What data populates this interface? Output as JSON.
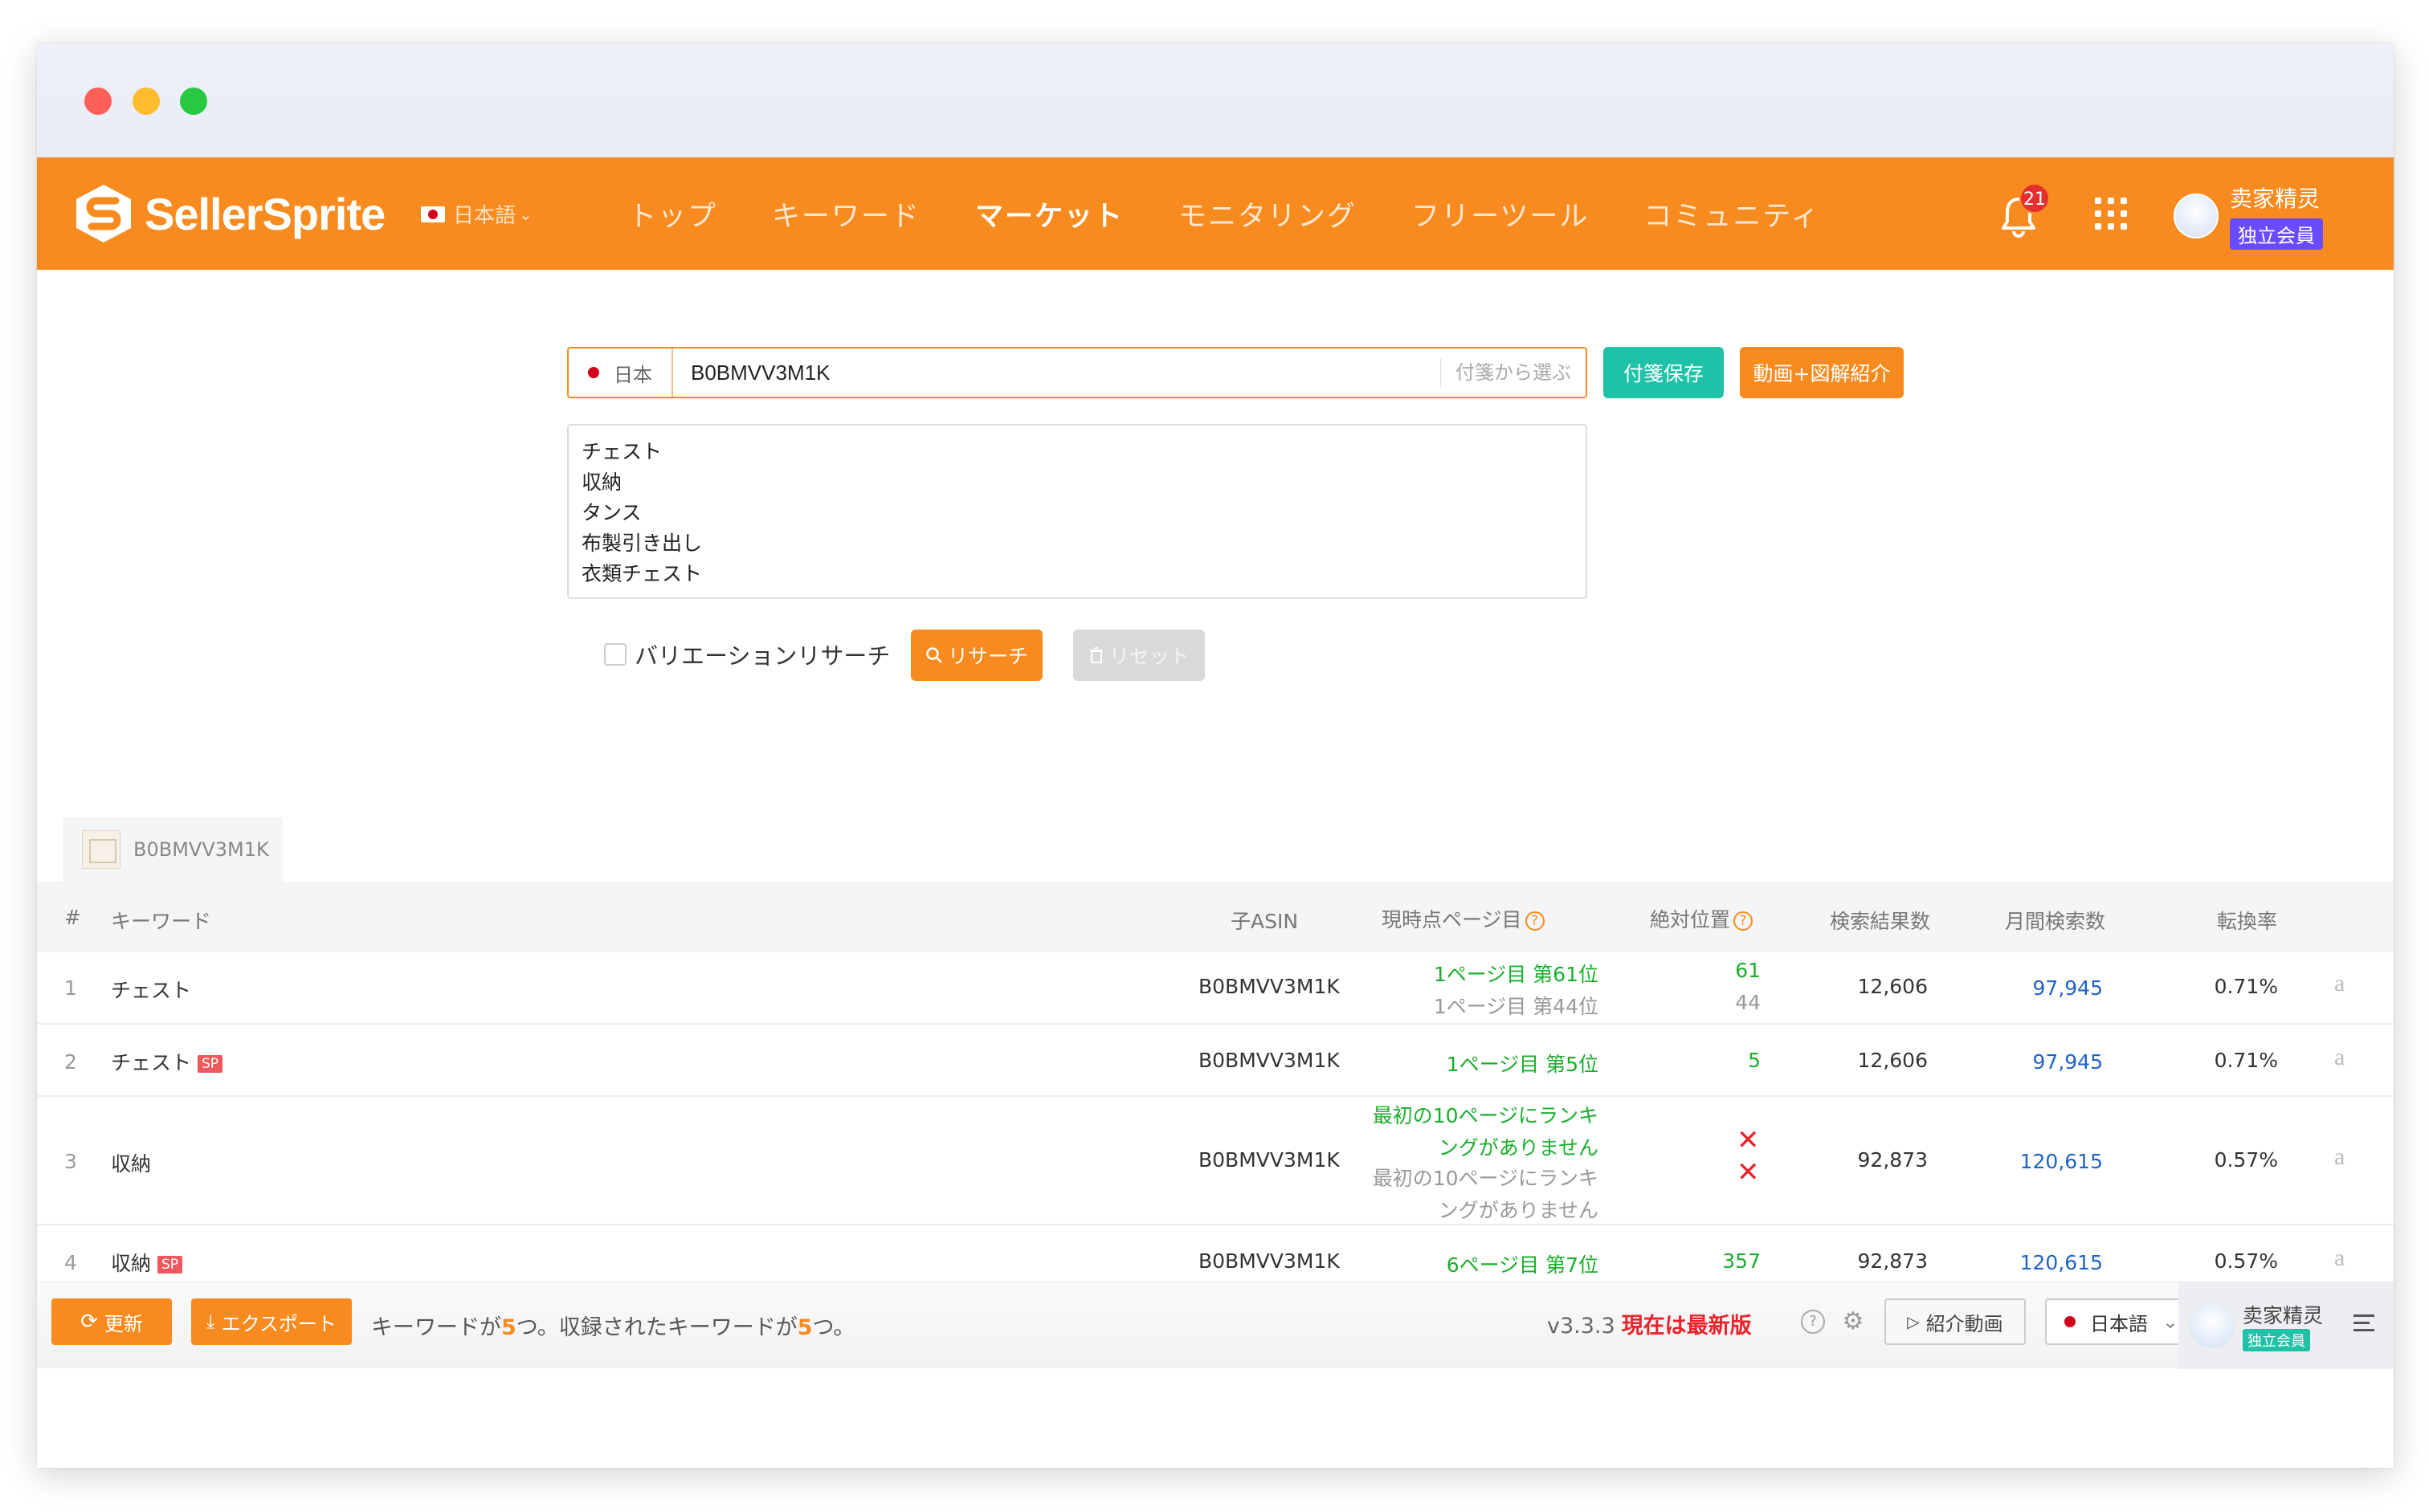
{
  "brand": {
    "name": "SellerSprite",
    "accent": "#f78b1f"
  },
  "nav": {
    "language": "日本語",
    "menu": [
      "トップ",
      "キーワード",
      "マーケット",
      "モニタリング",
      "フリーツール",
      "コミュニティ"
    ],
    "active_menu": "マーケット",
    "notification_count": "21",
    "user_name": "卖家精灵",
    "user_badge": "独立会員"
  },
  "search": {
    "marketplace": "日本",
    "asin_value": "B0BMVV3M1K",
    "tag_pick": "付箋から選ぶ",
    "save_button": "付箋保存",
    "video_button": "動画+図解紹介",
    "keywords_text": "チェスト\n収納\nタンス\n布製引き出し\n衣類チェスト",
    "variation_label": "バリエーションリサーチ",
    "research_button": "リサーチ",
    "reset_button": "リセット"
  },
  "tab": {
    "asin": "B0BMVV3M1K"
  },
  "table": {
    "headers": {
      "index": "#",
      "keyword": "キーワード",
      "child_asin": "子ASIN",
      "current_page": "現時点ページ目",
      "absolute_position": "絶対位置",
      "search_results": "検索結果数",
      "monthly_searches": "月間検索数",
      "conversion": "転換率"
    },
    "rows": [
      {
        "index": "1",
        "keyword": "チェスト",
        "sp": "",
        "asin": "B0BMVV3M1K",
        "page_line1": "1ページ目 第61位",
        "page_line2": "1ページ目 第44位",
        "pos1": "61",
        "pos2": "44",
        "results": "12,606",
        "monthly": "97,945",
        "conversion": "0.71%"
      },
      {
        "index": "2",
        "keyword": "チェスト",
        "sp": "SP",
        "asin": "B0BMVV3M1K",
        "page_line1": "1ページ目 第5位",
        "page_line2": "",
        "pos1": "5",
        "pos2": "",
        "results": "12,606",
        "monthly": "97,945",
        "conversion": "0.71%"
      },
      {
        "index": "3",
        "keyword": "収納",
        "sp": "",
        "asin": "B0BMVV3M1K",
        "page_line1a": "最初の10ページにランキ",
        "page_line1b": "ングがありません",
        "page_line2a": "最初の10ページにランキ",
        "page_line2b": "ングがありません",
        "results": "92,873",
        "monthly": "120,615",
        "conversion": "0.57%"
      },
      {
        "index": "4",
        "keyword": "収納",
        "sp": "SP",
        "asin": "B0BMVV3M1K",
        "page_line1": "6ページ目 第7位",
        "pos1": "357",
        "results": "92,873",
        "monthly": "120,615",
        "conversion": "0.57%"
      }
    ],
    "amazon_icon": "a"
  },
  "footer": {
    "update_button": "更新",
    "export_button": "エクスポート",
    "summary_a": "キーワードが",
    "summary_count1": "5",
    "summary_b": "つ。収録されたキーワードが",
    "summary_count2": "5",
    "summary_c": "つ。",
    "version": "v3.3.3",
    "latest": "現在は最新版",
    "intro_video": "紹介動画",
    "language": "日本語",
    "user_name": "卖家精灵",
    "user_badge": "独立会員"
  }
}
